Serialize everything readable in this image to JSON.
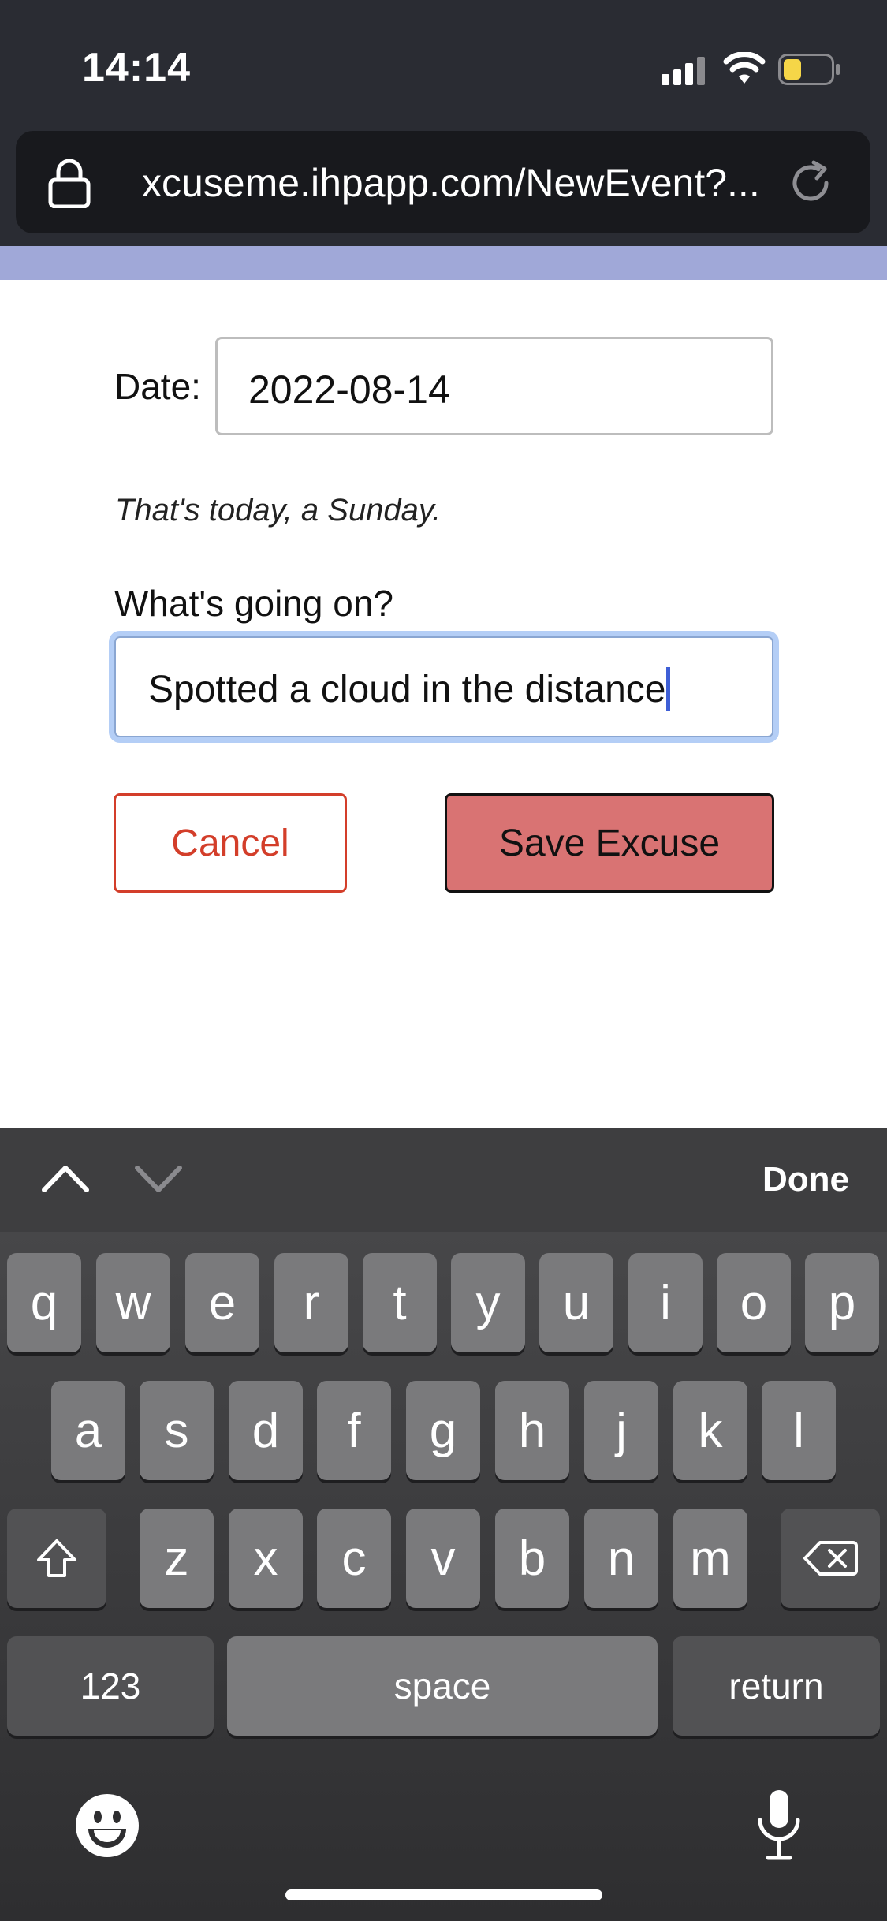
{
  "status_bar": {
    "time": "14:14"
  },
  "browser": {
    "url": "xcuseme.ihpapp.com/NewEvent?..."
  },
  "form": {
    "date_label": "Date:",
    "date_value": "2022-08-14",
    "date_note": "That's today, a Sunday.",
    "question_label": "What's going on?",
    "description_value": "Spotted a cloud in the distance",
    "cancel_label": "Cancel",
    "save_label": "Save Excuse"
  },
  "colors": {
    "cancel_accent": "#d33e2a",
    "save_background": "#d97373",
    "header_accent": "#a0a8d8",
    "focus_ring": "#b4cef6"
  },
  "keyboard": {
    "toolbar": {
      "done_label": "Done",
      "prev_icon": "chevron-up-icon",
      "next_icon": "chevron-down-icon"
    },
    "row1": [
      "q",
      "w",
      "e",
      "r",
      "t",
      "y",
      "u",
      "i",
      "o",
      "p"
    ],
    "row2": [
      "a",
      "s",
      "d",
      "f",
      "g",
      "h",
      "j",
      "k",
      "l"
    ],
    "row3": [
      "z",
      "x",
      "c",
      "v",
      "b",
      "n",
      "m"
    ],
    "numbers_label": "123",
    "space_label": "space",
    "return_label": "return",
    "icons": {
      "shift": "shift-icon",
      "delete": "delete-icon",
      "emoji": "emoji-icon",
      "mic": "microphone-icon"
    }
  }
}
